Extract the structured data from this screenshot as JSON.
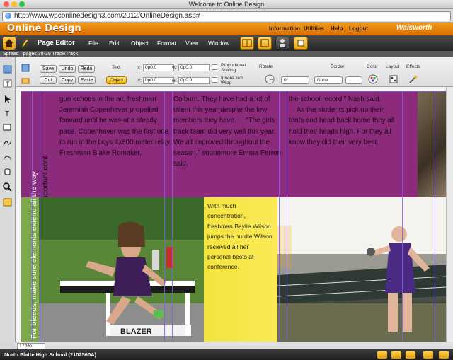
{
  "window": {
    "title": "Welcome to Online Design"
  },
  "browser": {
    "url": "http://www.wpconlinedesign3.com/2012/OnlineDesign.asp#"
  },
  "brand": {
    "logo": "Online Design",
    "nav": [
      "Information",
      "Utilities",
      "Help",
      "Logout"
    ],
    "partner": "Walsworth"
  },
  "menubar": {
    "page_editor": "Page Editor",
    "items": [
      "File",
      "Edit",
      "Object",
      "Format",
      "View",
      "Window"
    ]
  },
  "spread": {
    "label": "Spread - pages 38-39 Track/Track"
  },
  "toolbar": {
    "save": "Save",
    "undo": "Undo",
    "redo": "Redo",
    "cut": "Cut",
    "copy": "Copy",
    "paste": "Paste",
    "text_label": "Text",
    "object_label": "Object",
    "x_label": "X:",
    "x_value": "0p0.0",
    "y_label": "Y:",
    "y_value": "0p0.0",
    "w_label": "W:",
    "w_value": "0p0.0",
    "h_label": "H:",
    "h_value": "0p0.0",
    "proportional": "Proportional Scaling",
    "ignore_wrap": "Ignore Text Wrap",
    "rotate_label": "Rotate",
    "rotate_value": "0°",
    "border_label": "Border",
    "border_value": "None",
    "color_label": "Color",
    "layout_label": "Layout",
    "effects_label": "Effects"
  },
  "canvas": {
    "bleed_note": "For bleeds, make sure elements extend all the way",
    "trim_note": "To avoid trimming, keep important cont",
    "column1": "gun echoes in the air, freshman Jeremiah Copenhaver propelled forward until he was at a steady pace. Copenhaver was the first one to run in the boys 4x800 meter relay. Freshman Blake Romaker,",
    "column2": "Colburn. They have had a lot of talent this year despite the few members they have.     “The girls track team did very well this year. We all improved throughout the season,” sophomore Emma Ferron said.",
    "column3": "the school record,” Nash said.     As the students pick up their tents and head back home they all hold their heads high. For they all know they did their very best.",
    "caption": "With much concentration, freshman Baylie Wilson jumps the hurdle.Wilson recieved all her personal bests at conference.",
    "hurdle_text": "BLAZER"
  },
  "footer": {
    "zoom": "176%",
    "school": "North Platte High School (2102560A)"
  },
  "colors": {
    "brand_orange": "#e67e00",
    "magenta_block": "#8c2b7c",
    "bleed_green": "#7ea84c",
    "caption_yellow": "#f5e33e",
    "guide_purple": "#7c5cff"
  }
}
